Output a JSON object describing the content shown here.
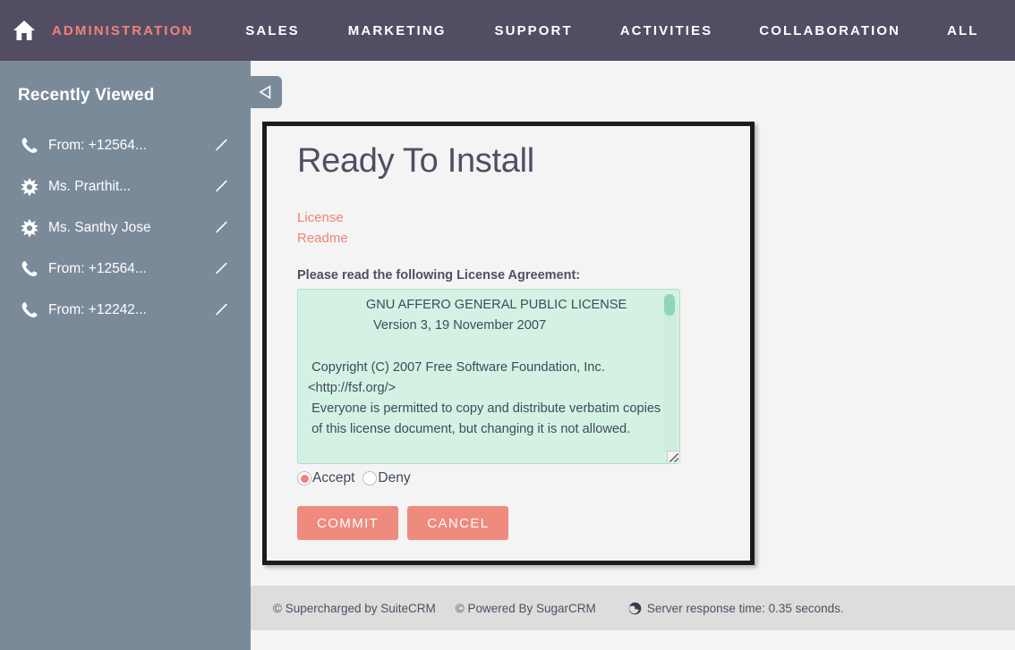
{
  "topnav": {
    "home_icon": "home-icon",
    "items": [
      {
        "label": "Administration",
        "active": true
      },
      {
        "label": "Sales",
        "active": false
      },
      {
        "label": "Marketing",
        "active": false
      },
      {
        "label": "Support",
        "active": false
      },
      {
        "label": "Activities",
        "active": false
      },
      {
        "label": "Collaboration",
        "active": false
      },
      {
        "label": "All",
        "active": false
      }
    ],
    "background_color": "#534d64",
    "active_color": "#f08377"
  },
  "sidebar": {
    "title": "Recently Viewed",
    "background_color": "#7b8a99",
    "collapse_icon": "triangle-left-icon",
    "items": [
      {
        "icon": "phone-icon",
        "label": "From: +12564...",
        "edit_icon": "pencil-icon"
      },
      {
        "icon": "star-burst-icon",
        "label": "Ms. Prarthit...",
        "edit_icon": "pencil-icon"
      },
      {
        "icon": "star-burst-icon",
        "label": "Ms. Santhy Jose",
        "edit_icon": "pencil-icon"
      },
      {
        "icon": "phone-icon",
        "label": "From: +12564...",
        "edit_icon": "pencil-icon"
      },
      {
        "icon": "phone-icon",
        "label": "From: +12242...",
        "edit_icon": "pencil-icon"
      }
    ]
  },
  "dialog": {
    "title": "Ready To Install",
    "links": [
      {
        "label": "License"
      },
      {
        "label": "Readme"
      }
    ],
    "license_prompt": "Please read the following License Agreement:",
    "license_text": "                GNU AFFERO GENERAL PUBLIC LICENSE\n                  Version 3, 19 November 2007\n\n Copyright (C) 2007 Free Software Foundation, Inc. <http://fsf.org/>\n Everyone is permitted to copy and distribute verbatim copies\n of this license document, but changing it is not allowed.",
    "radio_accept_label": "Accept",
    "radio_deny_label": "Deny",
    "radio_selected": "Accept",
    "commit_label": "Commit",
    "cancel_label": "Cancel",
    "accent_color": "#ef8a7e",
    "license_bg_color": "#d4f2e3"
  },
  "footer": {
    "suitecrm": "© Supercharged by SuiteCRM",
    "sugarcrm": "© Powered By SugarCRM",
    "globe_icon": "globe-icon",
    "server_response": "Server response time: 0.35 seconds."
  }
}
